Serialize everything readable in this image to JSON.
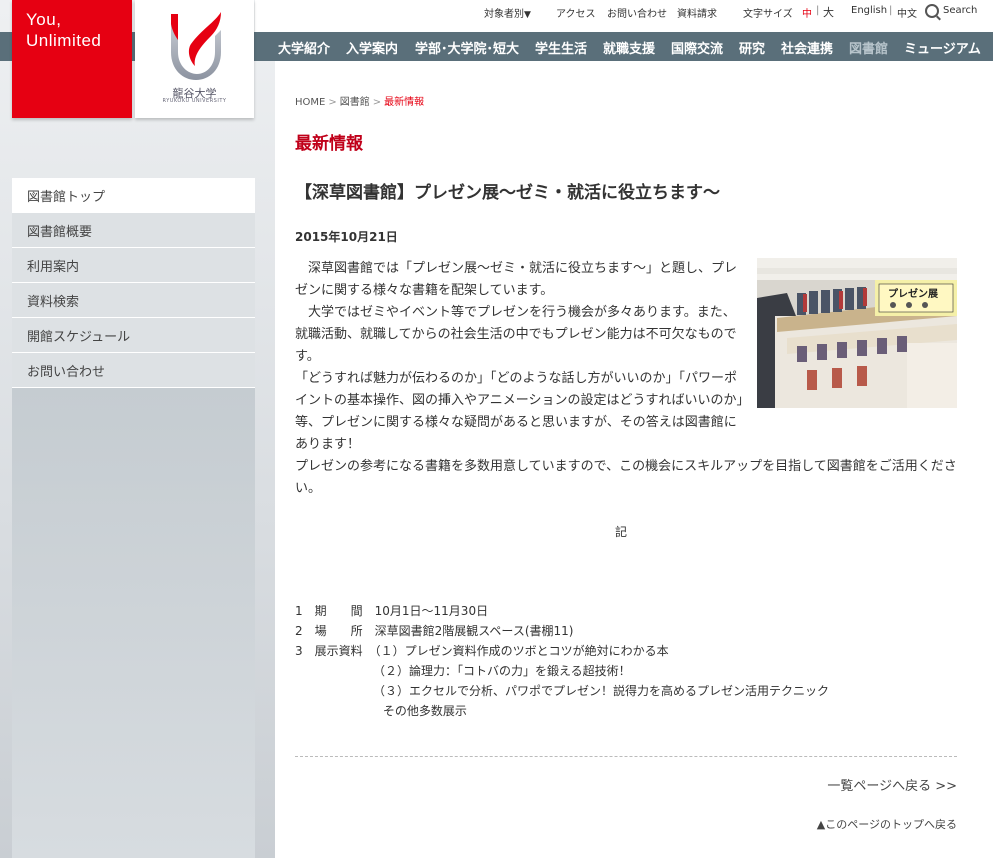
{
  "utility": {
    "target": "対象者別",
    "access": "アクセス",
    "contact": "お問い合わせ",
    "materials": "資料請求",
    "fontsize": "文字サイズ",
    "fs_medium": "中",
    "fs_sep": "|",
    "fs_large": "大",
    "english": "English",
    "lang_sep": "|",
    "chinese": "中文",
    "search": "Search"
  },
  "nav": [
    "大学紹介",
    "入学案内",
    "学部･大学院･短大",
    "学生生活",
    "就職支援",
    "国際交流",
    "研究",
    "社会連携",
    "図書館",
    "ミュージアム"
  ],
  "logo": {
    "line1": "You,",
    "line2": "Unlimited",
    "name": "龍谷大学",
    "name_en": "RYUKOKU UNIVERSITY"
  },
  "sidebar": [
    "図書館トップ",
    "図書館概要",
    "利用案内",
    "資料検索",
    "開館スケジュール",
    "お問い合わせ"
  ],
  "breadcrumb": {
    "home": "HOME",
    "library": "図書館",
    "current": "最新情報"
  },
  "heading": "最新情報",
  "article": {
    "title": "【深草図書館】プレゼン展～ゼミ・就活に役立ちます～",
    "date": "2015年10月21日",
    "p1": "　深草図書館では「プレゼン展～ゼミ・就活に役立ちます～」と題し、プレゼンに関する様々な書籍を配架しています。",
    "p2": "　大学ではゼミやイベント等でプレゼンを行う機会が多々あります。また、就職活動、就職してからの社会生活の中でもプレゼン能力は不可欠なものです。",
    "p3": "「どうすれば魅力が伝わるのか」「どのような話し方がいいのか」「パワーポイントの基本操作、図の挿入やアニメーションの設定はどうすればいいのか」等、プレゼンに関する様々な疑問があると思いますが、その答えは図書館にあります！",
    "p4": "プレゼンの参考になる書籍を多数用意していますので、この機会にスキルアップを目指して図書館をご活用ください。",
    "ki": "記",
    "details": [
      "1　期　　間　10月1日～11月30日",
      "2　場　　所　深草図書館2階展観スペース(書棚11)",
      "3　展示資料　（１）プレゼン資料作成のツボとコツが絶対にわかる本",
      "　　　　　　　（２）論理力：「コトバの力」を鍛える超技術！",
      "　　　　　　　（３）エクセルで分析、パワポでプレゼン！説得力を高めるプレゼン活用テクニック",
      "　　　　　　　  その他多数展示"
    ],
    "photo_sign": "プレゼン展"
  },
  "back_link": "一覧ページへ戻る >>",
  "top_link": "▲このページのトップへ戻る"
}
